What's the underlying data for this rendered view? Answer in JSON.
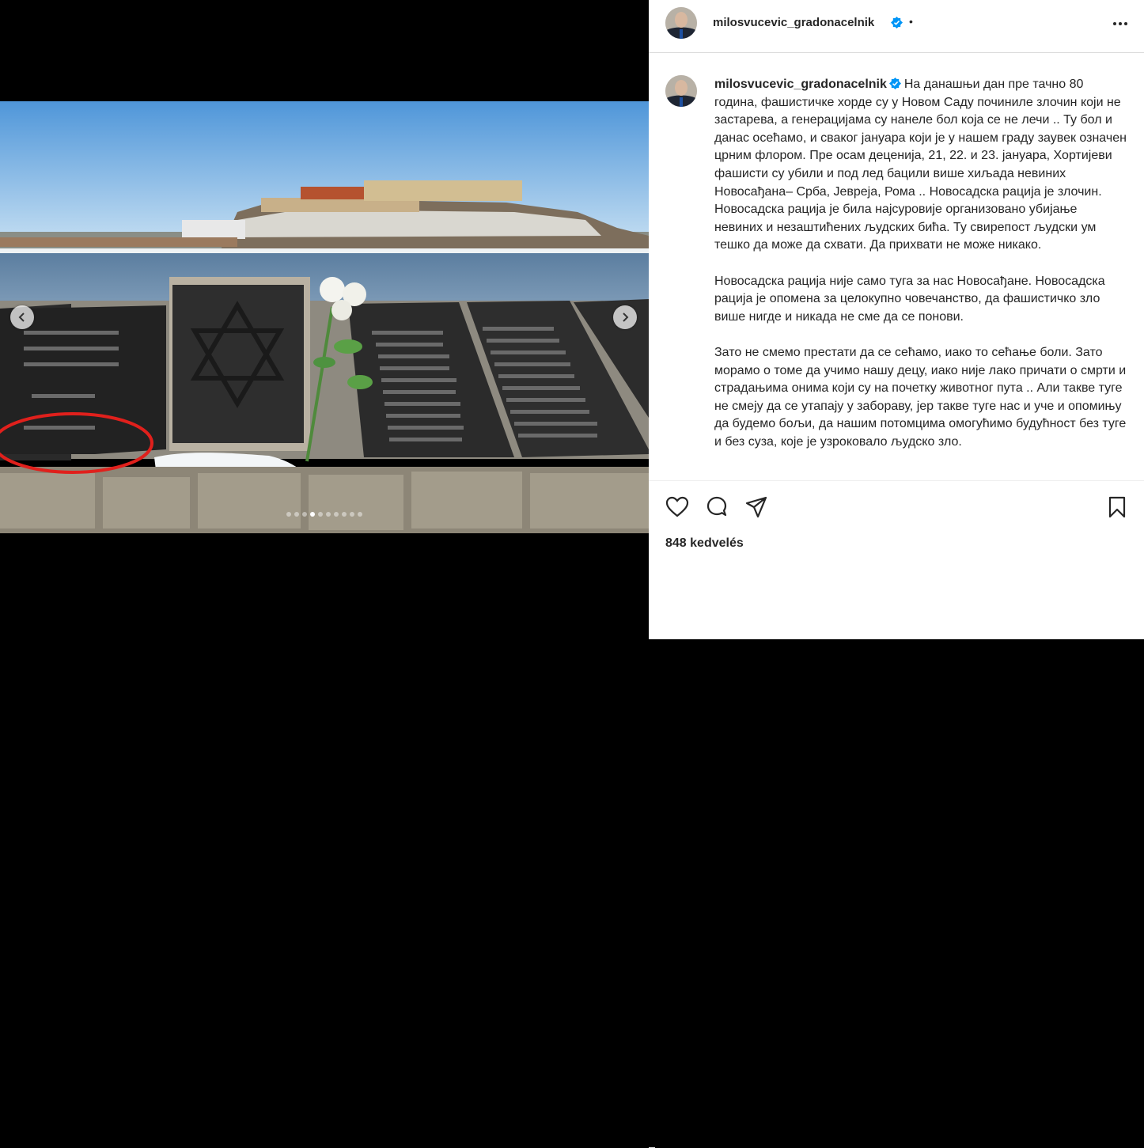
{
  "post": {
    "username": "milosvucevic_gradonacelnik",
    "separator": "•",
    "verified_icon": "verified-badge-icon",
    "more_icon": "more-options-icon",
    "caption": {
      "p1": "На данашњи дан пре тачно 80 година, фашистичке хорде су у Новом Саду починиле злочин који не застарева, а генерацијама су нанеле бол која се не лечи .. Ту бол и данас осећамо, и сваког јануара који је у нашем граду заувек означен црним флором. Пре осам деценија, 21, 22. и 23. јануара, Хортијеви фашисти су убили и под лед бацили више хиљада невиних Новосађана– Срба, Јевреја, Рома .. Новосадска рација је злочин. Новосадска рација је била најсуровије организовано убијање невиних и незаштићених људских бића. Ту свирепост људски ум тешко да може да схвати. Да прихвати не може никако.",
      "p2": "Новосадска рација није само туга за нас Новосађане. Новосадска рација је опомена за целокупно човечанство, да фашистичко зло више нигде и никада не сме да се понови.",
      "p3": "Зато не смемо престати да се сећамо, иако то сећање боли. Зато морамо о томе да учимо нашу децу, иако није лако причати о смрти и страдањима онима који су на почетку животног пута .. Али такве туге не смеју да се утапају у забораву, јер такве туге нас и уче и опомињу да будемо бољи, да нашим потомцима омогућимо будућност без туге и без суза, које је узроковало људско зло."
    },
    "likes": "848 kedvelés",
    "carousel": {
      "slide_count": 10,
      "active_index": 3,
      "prev_icon": "chevron-left-icon",
      "next_icon": "chevron-right-icon"
    },
    "actions": {
      "like_icon": "heart-icon",
      "comment_icon": "comment-icon",
      "share_icon": "paper-plane-icon",
      "save_icon": "bookmark-icon"
    }
  }
}
